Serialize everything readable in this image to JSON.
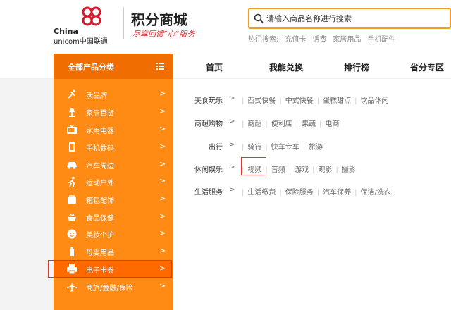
{
  "logo": {
    "line1": "China",
    "line2": "unicom中国联通"
  },
  "brand": {
    "title": "积分商城",
    "slogan": "尽享回馈“心”服务"
  },
  "search": {
    "placeholder": "请输入商品名称进行搜索"
  },
  "hot_search": {
    "label": "热门搜索:",
    "terms": [
      "充值卡",
      "话费",
      "家居用品",
      "手机配件"
    ]
  },
  "categories_header": "全部产品分类",
  "nav": [
    "首页",
    "我能兑换",
    "排行榜",
    "省分专区"
  ],
  "sidebar": [
    {
      "label": "沃品牌",
      "icon": "satellite-icon"
    },
    {
      "label": "家居百货",
      "icon": "lamp-icon"
    },
    {
      "label": "家用电器",
      "icon": "tv-icon"
    },
    {
      "label": "手机数码",
      "icon": "phone-icon"
    },
    {
      "label": "汽车周边",
      "icon": "car-icon"
    },
    {
      "label": "运动户外",
      "icon": "runner-icon"
    },
    {
      "label": "箱包配饰",
      "icon": "bag-icon"
    },
    {
      "label": "食品保健",
      "icon": "food-icon"
    },
    {
      "label": "美妆个护",
      "icon": "face-icon"
    },
    {
      "label": "母婴用品",
      "icon": "bottle-icon"
    },
    {
      "label": "电子卡券",
      "icon": "printer-icon",
      "active": true
    },
    {
      "label": "商旅/金融/保险",
      "icon": "plane-icon"
    }
  ],
  "arrow": ">",
  "panel_rows": [
    {
      "category": "美食玩乐",
      "items": [
        "西式快餐",
        "中式快餐",
        "蛋糕甜点",
        "饮品休闲"
      ]
    },
    {
      "category": "商超购物",
      "items": [
        "商超",
        "便利店",
        "果蔬",
        "电商"
      ]
    },
    {
      "category": "出行",
      "items": [
        "骑行",
        "快车专车",
        "旅游"
      ]
    },
    {
      "category": "休闲娱乐",
      "items": [
        "视频",
        "音频",
        "游戏",
        "观影",
        "摄影"
      ]
    },
    {
      "category": "生活服务",
      "items": [
        "生活缴费",
        "保险服务",
        "汽车保养",
        "保洁/洗衣"
      ]
    }
  ],
  "colors": {
    "accent": "#ff8a14",
    "accent_dark": "#f06d00",
    "highlight": "#d9362e",
    "search_border": "#f39b25"
  }
}
